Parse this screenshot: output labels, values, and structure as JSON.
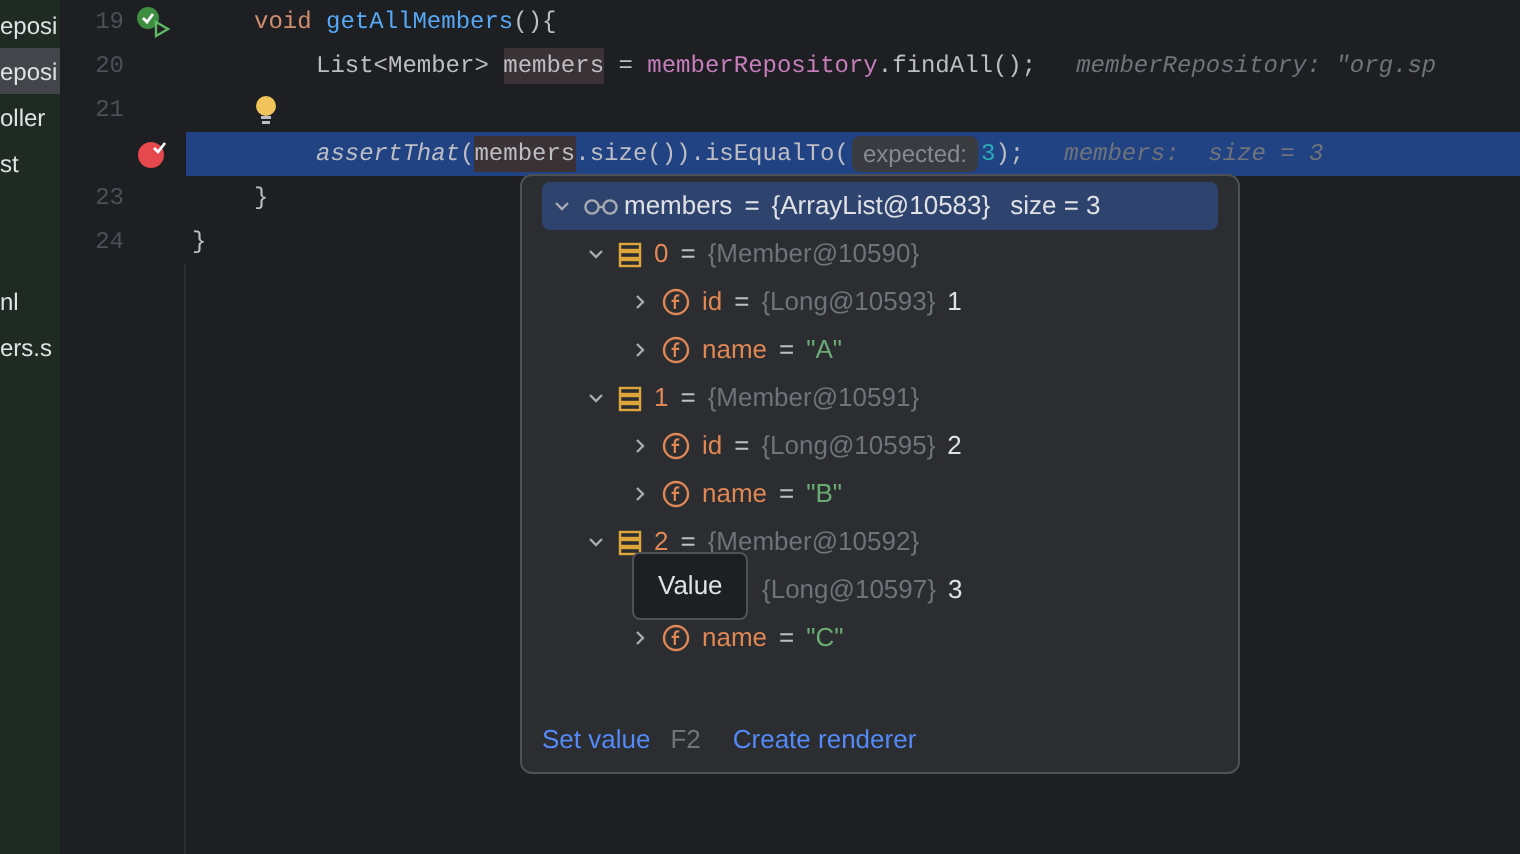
{
  "project_tree": [
    {
      "label": "eposi",
      "selected": false
    },
    {
      "label": "eposi",
      "selected": true
    },
    {
      "label": "oller",
      "selected": false
    },
    {
      "label": "st",
      "selected": false
    },
    {
      "selected": false
    },
    {
      "selected": false
    },
    {
      "label": "nl",
      "selected": false
    },
    {
      "label": "ers.s",
      "selected": false
    }
  ],
  "editor": {
    "lines": [
      {
        "number": "19",
        "kind": "run",
        "current": false,
        "tokens": [
          {
            "kind": "keyword",
            "text": "void "
          },
          {
            "kind": "method",
            "text": "getAllMembers"
          },
          {
            "kind": "plain",
            "text": "(){"
          }
        ],
        "children": [
          {
            "number": "20",
            "kind": "plain",
            "current": false,
            "tokens": [
              {
                "kind": "plain",
                "text": "List<Member> "
              },
              {
                "kind": "local",
                "text": "members"
              },
              {
                "kind": "plain",
                "text": " = "
              },
              {
                "kind": "field",
                "text": "memberRepository"
              },
              {
                "kind": "plain",
                "text": ".findAll();"
              },
              {
                "kind": "hint",
                "text": "memberRepository: \"org.sp"
              }
            ]
          },
          {
            "number": "21",
            "kind": "bulb",
            "current": false
          },
          {
            "kind": "breakpoint",
            "current": true,
            "tokens": [
              {
                "kind": "static",
                "text": "assertThat"
              },
              {
                "kind": "plain",
                "text": "("
              },
              {
                "kind": "local",
                "text": "members"
              },
              {
                "kind": "plain",
                "text": ".size()).isEqualTo("
              },
              {
                "kind": "param",
                "text": "expected:"
              },
              {
                "kind": "number",
                "text": "3"
              },
              {
                "kind": "plain",
                "text": ");"
              },
              {
                "kind": "hint",
                "text": "members:  size = 3"
              }
            ]
          }
        ]
      },
      {
        "number": "23",
        "kind": "closing",
        "current": false,
        "tokens": [
          {
            "kind": "plain",
            "text": "}"
          }
        ]
      },
      {
        "number": "24",
        "kind": "outer",
        "current": false,
        "tokens": [
          {
            "kind": "plain",
            "text": "}"
          }
        ]
      }
    ]
  },
  "popup": {
    "root": {
      "name": "members",
      "op": "=",
      "type_value": "{ArrayList@10583}",
      "value": "size = 3",
      "expanded": true,
      "selected": true,
      "children": [
        {
          "kind": "element",
          "name": "0",
          "op": "=",
          "type_value": "{Member@10590}",
          "expanded": true,
          "children": [
            {
              "kind": "field",
              "name": "id",
              "op": "=",
              "type_value": "{Long@10593}",
              "value": "1",
              "expanded": false
            },
            {
              "kind": "field",
              "name": "name",
              "op": "=",
              "string": "\"A\"",
              "expanded": false
            }
          ]
        },
        {
          "kind": "element",
          "name": "1",
          "op": "=",
          "type_value": "{Member@10591}",
          "expanded": true,
          "children": [
            {
              "kind": "field",
              "name": "id",
              "op": "=",
              "type_value": "{Long@10595}",
              "value": "2",
              "expanded": false
            },
            {
              "kind": "field",
              "name": "name",
              "op": "=",
              "string": "\"B\"",
              "expanded": false
            }
          ]
        },
        {
          "kind": "element",
          "name": "2",
          "op": "=",
          "type_value": "{Member@10592}",
          "expanded": true,
          "children": [
            {
              "kind": "covered",
              "type_value": "{Long@10597}",
              "value": "3"
            },
            {
              "kind": "field",
              "name": "name",
              "op": "=",
              "string": "\"C\"",
              "expanded": false
            }
          ]
        }
      ]
    },
    "tooltip": "Value",
    "actions": [
      {
        "label": "Set value",
        "shortcut": "F2"
      },
      {
        "label": "Create renderer"
      }
    ]
  }
}
